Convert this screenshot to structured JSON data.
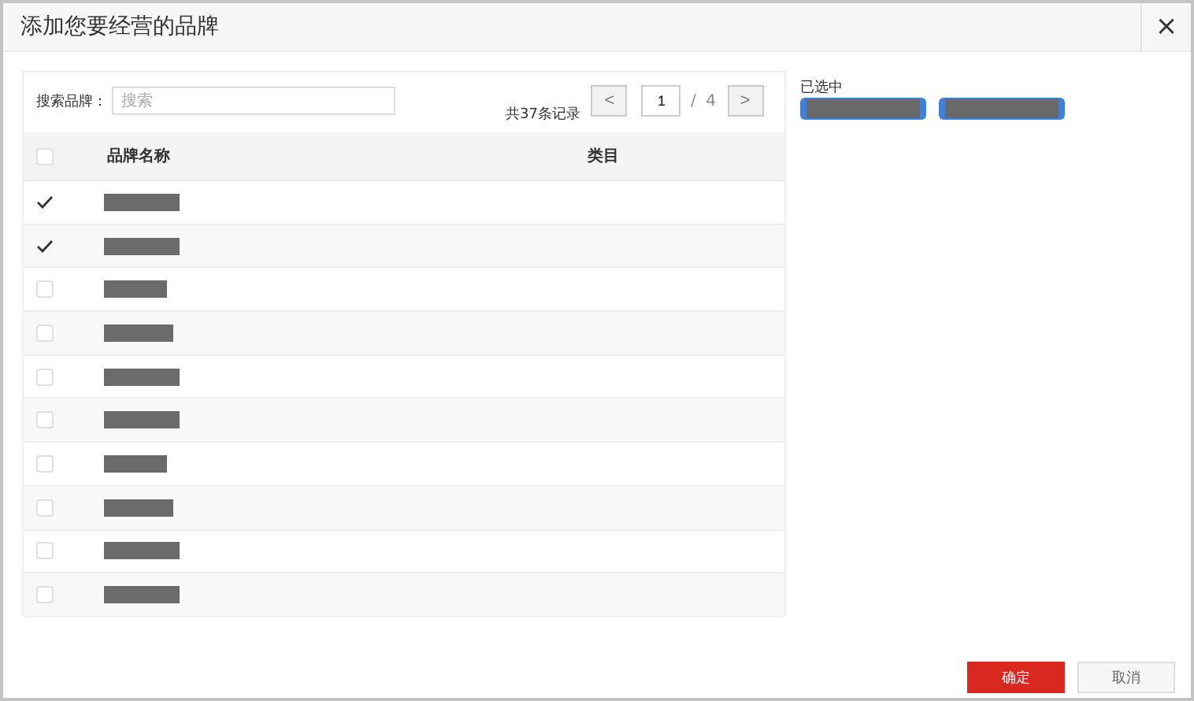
{
  "window": {
    "title": "添加您要经营的品牌",
    "close": "×"
  },
  "search": {
    "label": "搜索品牌：",
    "placeholder": "搜索"
  },
  "pagination": {
    "total": "共37条记录",
    "prev": "<",
    "page": "1",
    "separator": "/",
    "pages": "4",
    "next": ">"
  },
  "table": {
    "columns": [
      "品牌名称",
      "类目"
    ],
    "header_checked": false,
    "rows": [
      {
        "checked": true,
        "kind": "redacted"
      },
      {
        "checked": true,
        "kind": "redacted"
      },
      {
        "checked": false,
        "kind": "redacted"
      },
      {
        "checked": false,
        "kind": "redacted"
      },
      {
        "checked": false,
        "kind": "redacted"
      },
      {
        "checked": false,
        "kind": "redacted"
      },
      {
        "checked": false,
        "kind": "redacted"
      },
      {
        "checked": false,
        "kind": "redacted"
      },
      {
        "checked": false,
        "kind": "redacted"
      },
      {
        "checked": false,
        "kind": "redacted"
      }
    ]
  },
  "selected_panel": {
    "label": "已选中",
    "items": [
      {
        "kind": "redacted"
      },
      {
        "kind": "redacted"
      }
    ]
  },
  "buttons": [
    {
      "label": "确定",
      "kind": "primary"
    },
    {
      "label": "取消",
      "kind": "secondary"
    }
  ]
}
